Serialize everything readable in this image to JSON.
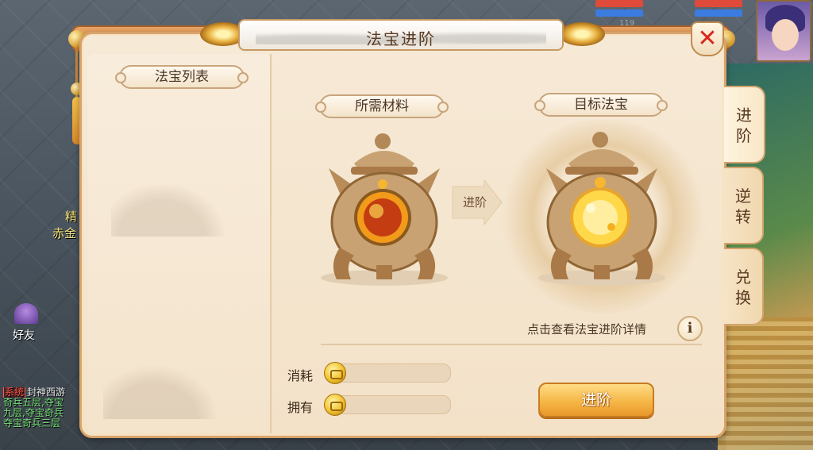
{
  "dialog": {
    "title": "法宝进阶",
    "close_icon": "close-icon"
  },
  "left_pane": {
    "header": "法宝列表"
  },
  "material": {
    "header": "所需材料"
  },
  "target": {
    "header": "目标法宝"
  },
  "arrow_label": "进阶",
  "tabs": [
    {
      "label": "进\n阶",
      "active": true
    },
    {
      "label": "逆\n转",
      "active": false
    },
    {
      "label": "兑\n换",
      "active": false
    }
  ],
  "detail_link": "点击查看法宝进阶详情",
  "info_icon_glyph": "i",
  "resources": {
    "cost_label": "消耗",
    "own_label": "拥有"
  },
  "advance_button": "进阶",
  "background": {
    "side_name_1": "精",
    "side_name_2": "赤金",
    "friend_label": "好友",
    "chat": {
      "tag": "系统",
      "lines": [
        "封神西游",
        "奇兵五层,夺宝",
        "九层,夺宝奇兵",
        "夺宝奇兵三层"
      ]
    },
    "hp_value": "119"
  },
  "colors": {
    "accent_orange": "#f5b747",
    "panel_bg": "#f6e9d6",
    "close_red": "#d9261c",
    "text_brown": "#4b3524"
  }
}
